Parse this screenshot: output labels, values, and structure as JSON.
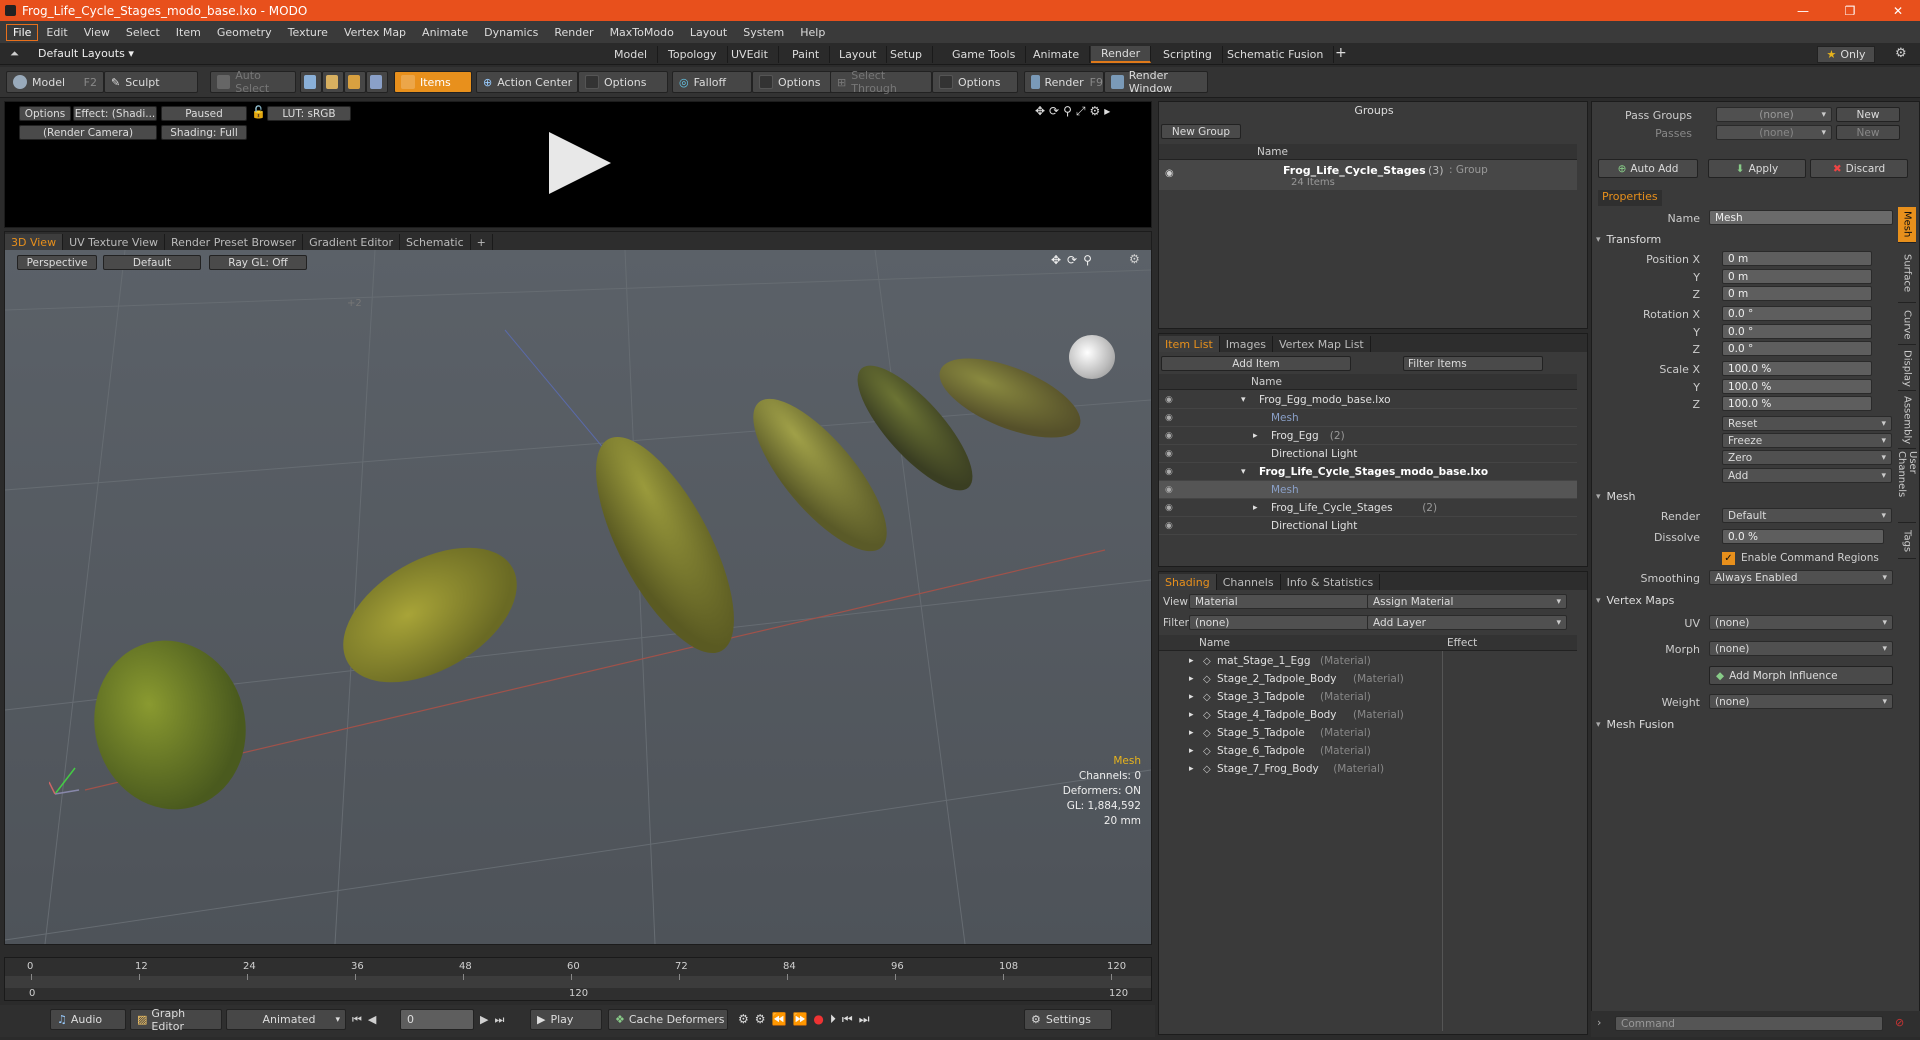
{
  "window": {
    "title": "Frog_Life_Cycle_Stages_modo_base.lxo - MODO"
  },
  "menu": [
    "File",
    "Edit",
    "View",
    "Select",
    "Item",
    "Geometry",
    "Texture",
    "Vertex Map",
    "Animate",
    "Dynamics",
    "Render",
    "MaxToModo",
    "Layout",
    "System",
    "Help"
  ],
  "layout": {
    "dropdown": "Default Layouts",
    "tabs": [
      "Model",
      "Topology",
      "UVEdit",
      "Paint",
      "Layout",
      "Setup",
      "Game Tools",
      "Animate",
      "Render",
      "Scripting",
      "Schematic Fusion"
    ],
    "selected_tab": "Render",
    "only_label": "Only"
  },
  "toolbar": {
    "model": "Model",
    "model_key": "F2",
    "sculpt": "Sculpt",
    "auto_select": "Auto Select",
    "items": "Items",
    "action_center": "Action Center",
    "options1": "Options",
    "falloff": "Falloff",
    "options2": "Options",
    "select_through": "Select Through",
    "options3": "Options",
    "render": "Render",
    "render_key": "F9",
    "render_window": "Render Window"
  },
  "preview": {
    "options": "Options",
    "effect": "Effect: (Shadi...",
    "paused": "Paused",
    "lut": "LUT: sRGB",
    "camera": "(Render Camera)",
    "shading": "Shading: Full"
  },
  "viewport": {
    "tabs": [
      "3D View",
      "UV Texture View",
      "Render Preset Browser",
      "Gradient Editor",
      "Schematic"
    ],
    "perspective": "Perspective",
    "default": "Default",
    "raygl": "Ray GL: Off",
    "ghost_label": "+2",
    "info": {
      "title": "Mesh",
      "channels": "Channels: 0",
      "deformers": "Deformers: ON",
      "gl": "GL: 1,884,592",
      "focal": "20 mm"
    }
  },
  "timeline": {
    "ticks": [
      "0",
      "12",
      "24",
      "36",
      "48",
      "60",
      "72",
      "84",
      "96",
      "108",
      "120"
    ],
    "sub_left": "0",
    "sub_mid": "120",
    "sub_right": "120"
  },
  "bottom": {
    "audio": "Audio",
    "graph_editor": "Graph Editor",
    "animated": "Animated",
    "frame": "0",
    "play": "Play",
    "cache": "Cache Deformers",
    "settings": "Settings"
  },
  "groups": {
    "title": "Groups",
    "new_group": "New Group",
    "col_name": "Name",
    "entry_name": "Frog_Life_Cycle_Stages",
    "entry_count": "(3)",
    "entry_type": ": Group",
    "entry_items": "24 Items"
  },
  "itemlist": {
    "tabs": [
      "Item List",
      "Images",
      "Vertex Map List"
    ],
    "add_item": "Add Item",
    "filter_items": "Filter Items",
    "col_name": "Name",
    "rows": [
      {
        "name": "Frog_Egg_modo_base.lxo",
        "indent": 0,
        "bold": false,
        "dim": false,
        "sel": false,
        "exp": "▾"
      },
      {
        "name": "Mesh",
        "indent": 1,
        "bold": false,
        "dim": true,
        "sel": false,
        "exp": ""
      },
      {
        "name": "Frog_Egg",
        "suffix": "(2)",
        "indent": 1,
        "bold": false,
        "dim": false,
        "sel": false,
        "exp": "▸"
      },
      {
        "name": "Directional Light",
        "indent": 1,
        "bold": false,
        "dim": false,
        "sel": false,
        "exp": ""
      },
      {
        "name": "Frog_Life_Cycle_Stages_modo_base.lxo",
        "indent": 0,
        "bold": true,
        "dim": false,
        "sel": false,
        "exp": "▾"
      },
      {
        "name": "Mesh",
        "indent": 1,
        "bold": false,
        "dim": true,
        "sel": true,
        "exp": ""
      },
      {
        "name": "Frog_Life_Cycle_Stages",
        "suffix": "(2)",
        "indent": 1,
        "bold": false,
        "dim": false,
        "sel": false,
        "exp": "▸"
      },
      {
        "name": "Directional Light",
        "indent": 1,
        "bold": false,
        "dim": false,
        "sel": false,
        "exp": ""
      }
    ]
  },
  "shading": {
    "tabs": [
      "Shading",
      "Channels",
      "Info & Statistics"
    ],
    "view_label": "View",
    "view_value": "Material",
    "assign": "Assign Material",
    "filter_label": "Filter",
    "filter_value": "(none)",
    "add_layer": "Add Layer",
    "col_name": "Name",
    "col_effect": "Effect",
    "rows": [
      {
        "name": "mat_Stage_1_Egg",
        "type": "(Material)"
      },
      {
        "name": "Stage_2_Tadpole_Body",
        "type": "(Material)"
      },
      {
        "name": "Stage_3_Tadpole",
        "type": "(Material)"
      },
      {
        "name": "Stage_4_Tadpole_Body",
        "type": "(Material)"
      },
      {
        "name": "Stage_5_Tadpole",
        "type": "(Material)"
      },
      {
        "name": "Stage_6_Tadpole",
        "type": "(Material)"
      },
      {
        "name": "Stage_7_Frog_Body",
        "type": "(Material)"
      }
    ]
  },
  "properties": {
    "pass_groups_label": "Pass Groups",
    "pass_groups_value": "(none)",
    "passes_label": "Passes",
    "passes_value": "(none)",
    "new1": "New",
    "new2": "New",
    "auto_add": "Auto Add",
    "apply": "Apply",
    "discard": "Discard",
    "tab": "Properties",
    "name_label": "Name",
    "name_value": "Mesh",
    "transform": "Transform",
    "position_label": "Position X",
    "rotation_label": "Rotation X",
    "scale_label": "Scale X",
    "y": "Y",
    "z": "Z",
    "pos": [
      "0 m",
      "0 m",
      "0 m"
    ],
    "rot": [
      "0.0 °",
      "0.0 °",
      "0.0 °"
    ],
    "scl": [
      "100.0 %",
      "100.0 %",
      "100.0 %"
    ],
    "reset": "Reset",
    "freeze": "Freeze",
    "zero": "Zero",
    "add": "Add",
    "mesh": "Mesh",
    "render_label": "Render",
    "render_value": "Default",
    "dissolve_label": "Dissolve",
    "dissolve_value": "0.0 %",
    "enable_cmd": "Enable Command Regions",
    "smoothing_label": "Smoothing",
    "smoothing_value": "Always Enabled",
    "vertex_maps": "Vertex Maps",
    "uv_label": "UV",
    "uv_value": "(none)",
    "morph_label": "Morph",
    "morph_value": "(none)",
    "add_morph": "Add Morph Influence",
    "weight_label": "Weight",
    "weight_value": "(none)",
    "mesh_fusion": "Mesh Fusion",
    "command_placeholder": "Command"
  },
  "side_tabs": [
    "Mesh",
    "Surface",
    "Curve",
    "Display",
    "Assembly",
    "User Channels",
    "Tags"
  ]
}
